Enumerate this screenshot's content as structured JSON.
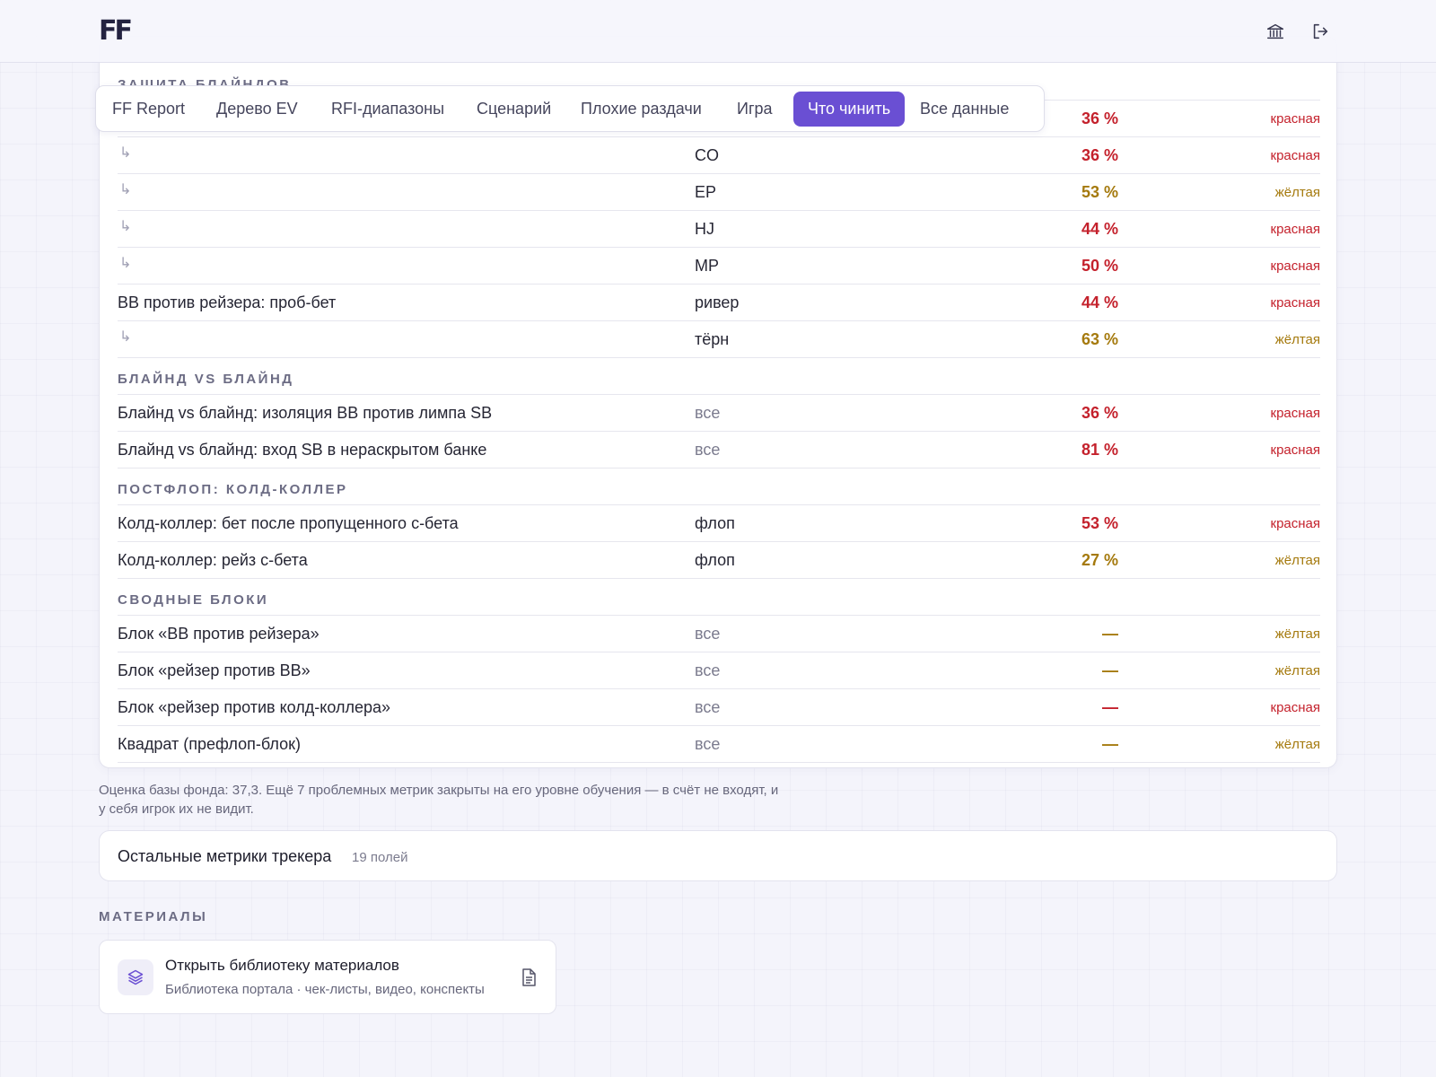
{
  "header": {
    "logo": "FF",
    "icons": [
      "bank-icon",
      "logout-icon"
    ]
  },
  "tabs": [
    {
      "label": "FF Report",
      "active": false
    },
    {
      "label": "Дерево EV",
      "active": false
    },
    {
      "label": "RFI-диапазоны",
      "active": false
    },
    {
      "label": "Сценарий",
      "active": false
    },
    {
      "label": "Плохие раздачи",
      "active": false
    },
    {
      "label": "Игра",
      "active": false
    },
    {
      "label": "Что чинить",
      "active": true
    },
    {
      "label": "Все данные",
      "active": false
    }
  ],
  "table": {
    "sections": [
      {
        "title": "Защита блайндов",
        "rows": [
          {
            "name": "",
            "sub": false,
            "street": "",
            "value": "36 %",
            "zone": "красная"
          },
          {
            "name": "",
            "sub": true,
            "street": "CO",
            "value": "36 %",
            "zone": "красная"
          },
          {
            "name": "",
            "sub": true,
            "street": "EP",
            "value": "53 %",
            "zone": "жёлтая"
          },
          {
            "name": "",
            "sub": true,
            "street": "HJ",
            "value": "44 %",
            "zone": "красная"
          },
          {
            "name": "",
            "sub": true,
            "street": "MP",
            "value": "50 %",
            "zone": "красная"
          },
          {
            "name": "BB против рейзера: проб-бет",
            "sub": false,
            "street": "ривер",
            "value": "44 %",
            "zone": "красная"
          },
          {
            "name": "",
            "sub": true,
            "street": "тёрн",
            "value": "63 %",
            "zone": "жёлтая"
          }
        ]
      },
      {
        "title": "Блайнд vs блайнд",
        "rows": [
          {
            "name": "Блайнд vs блайнд: изоляция BB против лимпа SB",
            "sub": false,
            "street": "все",
            "value": "36 %",
            "zone": "красная"
          },
          {
            "name": "Блайнд vs блайнд: вход SB в нераскрытом банке",
            "sub": false,
            "street": "все",
            "value": "81 %",
            "zone": "красная"
          }
        ]
      },
      {
        "title": "Постфлоп: колд-коллер",
        "rows": [
          {
            "name": "Колд-коллер: бет после пропущенного с-бета",
            "sub": false,
            "street": "флоп",
            "value": "53 %",
            "zone": "красная"
          },
          {
            "name": "Колд-коллер: рейз с-бета",
            "sub": false,
            "street": "флоп",
            "value": "27 %",
            "zone": "жёлтая"
          }
        ]
      },
      {
        "title": "Сводные блоки",
        "rows": [
          {
            "name": "Блок «BB против рейзера»",
            "sub": false,
            "street": "все",
            "value": "—",
            "zone": "жёлтая"
          },
          {
            "name": "Блок «рейзер против BB»",
            "sub": false,
            "street": "все",
            "value": "—",
            "zone": "жёлтая"
          },
          {
            "name": "Блок «рейзер против колд-коллера»",
            "sub": false,
            "street": "все",
            "value": "—",
            "zone": "красная"
          },
          {
            "name": "Квадрат (префлоп-блок)",
            "sub": false,
            "street": "все",
            "value": "—",
            "zone": "жёлтая"
          }
        ]
      }
    ]
  },
  "note": "Оценка базы фонда: 37,3. Ещё 7 проблемных метрик закрыты на его уровне обучения — в счёт не входят, и у себя игрок их не видит.",
  "other_metrics": {
    "title": "Остальные метрики трекера",
    "count": "19 полей"
  },
  "materials": {
    "heading": "Материалы",
    "card": {
      "title": "Открыть библиотеку материалов",
      "subtitle": "Библиотека портала · чек-листы, видео, конспекты"
    }
  },
  "colors": {
    "accent": "#6a4fd3",
    "red": "#c4212c",
    "yellow": "#a57a0e"
  }
}
